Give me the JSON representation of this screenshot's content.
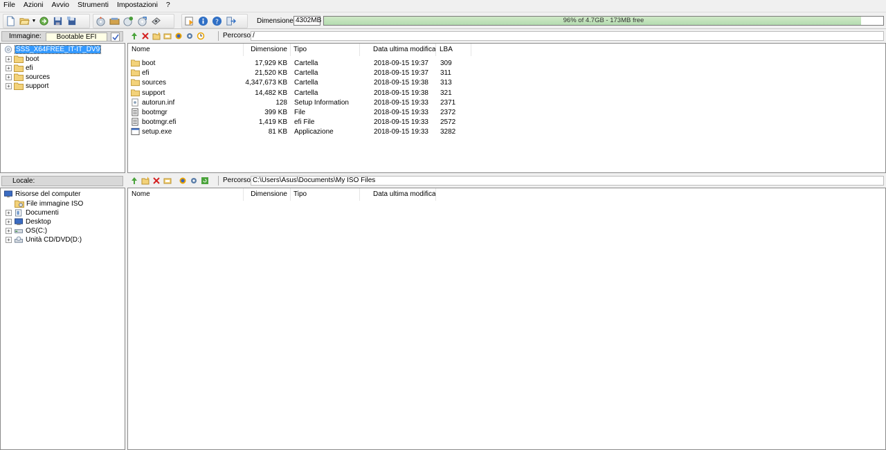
{
  "menu": [
    "File",
    "Azioni",
    "Avvio",
    "Strumenti",
    "Impostazioni",
    "?"
  ],
  "toolbar": {
    "dimension_label": "Dimensione:",
    "dimension_value": "4302MB",
    "capacity_text": "96% of 4.7GB - 173MB free",
    "capacity_percent": 96
  },
  "image_pane": {
    "label": "Immagine:",
    "image_name": "Bootable EFI",
    "path_label": "Percorso:",
    "path": "/"
  },
  "iso_tree": {
    "root": "SSS_X64FREE_IT-IT_DV9",
    "children": [
      "boot",
      "efi",
      "sources",
      "support"
    ]
  },
  "iso_columns": [
    "Nome",
    "Dimensione",
    "Tipo",
    "Data ultima modifica",
    "LBA"
  ],
  "iso_files": [
    {
      "name": "boot",
      "size": "17,929 KB",
      "type": "Cartella",
      "date": "2018-09-15 19:37",
      "lba": "309",
      "icon": "folder-icon"
    },
    {
      "name": "efi",
      "size": "21,520 KB",
      "type": "Cartella",
      "date": "2018-09-15 19:37",
      "lba": "311",
      "icon": "folder-icon"
    },
    {
      "name": "sources",
      "size": "4,347,673 KB",
      "type": "Cartella",
      "date": "2018-09-15 19:38",
      "lba": "313",
      "icon": "folder-icon"
    },
    {
      "name": "support",
      "size": "14,482 KB",
      "type": "Cartella",
      "date": "2018-09-15 19:38",
      "lba": "321",
      "icon": "folder-icon"
    },
    {
      "name": "autorun.inf",
      "size": "128",
      "type": "Setup Information",
      "date": "2018-09-15 19:33",
      "lba": "2371",
      "icon": "settings-file-icon"
    },
    {
      "name": "bootmgr",
      "size": "399 KB",
      "type": "File",
      "date": "2018-09-15 19:33",
      "lba": "2372",
      "icon": "file-icon"
    },
    {
      "name": "bootmgr.efi",
      "size": "1,419 KB",
      "type": "efi File",
      "date": "2018-09-15 19:33",
      "lba": "2572",
      "icon": "file-icon"
    },
    {
      "name": "setup.exe",
      "size": "81 KB",
      "type": "Applicazione",
      "date": "2018-09-15 19:33",
      "lba": "3282",
      "icon": "application-icon"
    }
  ],
  "local_pane": {
    "label": "Locale:",
    "path_label": "Percorso:",
    "path": "C:\\Users\\Asus\\Documents\\My ISO Files"
  },
  "local_tree": {
    "root": "Risorse del computer",
    "children": [
      "File immagine ISO",
      "Documenti",
      "Desktop",
      "OS(C:)",
      "Unità CD/DVD(D:)"
    ]
  },
  "local_columns": [
    "Nome",
    "Dimensione",
    "Tipo",
    "Data ultima modifica"
  ],
  "colors": {
    "selection": "#3399ff",
    "capacity_fill": "#b4dcb0",
    "folder": "#f3d27a"
  }
}
